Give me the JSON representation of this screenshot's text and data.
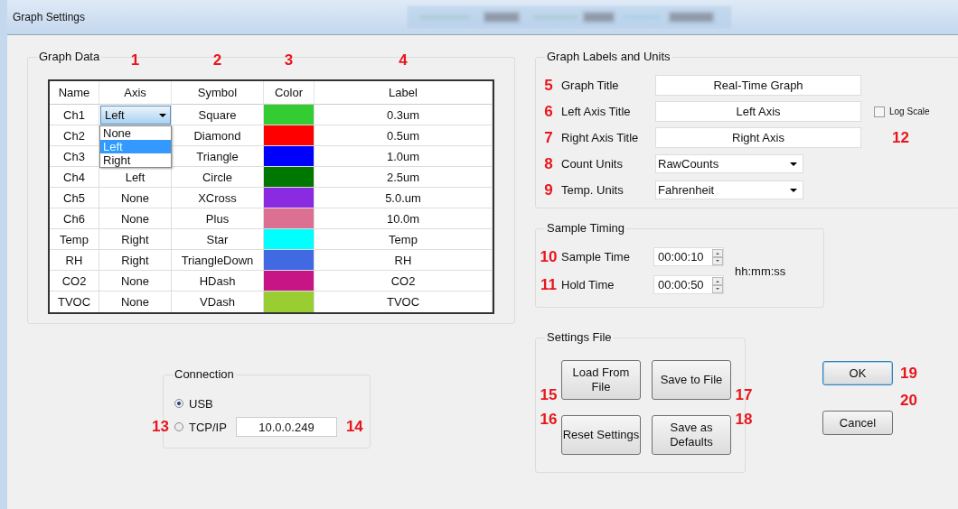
{
  "window": {
    "title": "Graph Settings"
  },
  "graph_data": {
    "title": "Graph Data",
    "columns": [
      {
        "label": "Name"
      },
      {
        "label": "Axis",
        "marker": "1"
      },
      {
        "label": "Symbol",
        "marker": "2"
      },
      {
        "label": "Color",
        "marker": "3"
      },
      {
        "label": "Label",
        "marker": "4"
      }
    ],
    "rows": [
      {
        "name": "Ch1",
        "axis": "Left",
        "symbol": "Square",
        "color": "#33cc33",
        "label": "0.3um",
        "editing": true
      },
      {
        "name": "Ch2",
        "symbol": "Diamond",
        "color": "#ff0000",
        "label": "0.5um",
        "editing": false
      },
      {
        "name": "Ch3",
        "symbol": "Triangle",
        "color": "#0000ff",
        "label": "1.0um",
        "editing": false
      },
      {
        "name": "Ch4",
        "axis": "Left",
        "symbol": "Circle",
        "color": "#007700",
        "label": "2.5um",
        "editing": false
      },
      {
        "name": "Ch5",
        "axis": "None",
        "symbol": "XCross",
        "color": "#8a2be2",
        "label": "5.0.um",
        "editing": false
      },
      {
        "name": "Ch6",
        "axis": "None",
        "symbol": "Plus",
        "color": "#db7093",
        "label": "10.0m",
        "editing": false
      },
      {
        "name": "Temp",
        "axis": "Right",
        "symbol": "Star",
        "color": "#00ffff",
        "label": "Temp",
        "editing": false
      },
      {
        "name": "RH",
        "axis": "Right",
        "symbol": "TriangleDown",
        "color": "#4169e1",
        "label": "RH",
        "editing": false
      },
      {
        "name": "CO2",
        "axis": "None",
        "symbol": "HDash",
        "color": "#c71585",
        "label": "CO2",
        "editing": false
      },
      {
        "name": "TVOC",
        "axis": "None",
        "symbol": "VDash",
        "color": "#9acd32",
        "label": "TVOC",
        "editing": false
      }
    ],
    "axis_options": [
      {
        "label": "None",
        "selected": false
      },
      {
        "label": "Left",
        "selected": true
      },
      {
        "label": "Right",
        "selected": false
      }
    ]
  },
  "connection": {
    "title": "Connection",
    "options": [
      {
        "label": "USB",
        "selected": true
      },
      {
        "label": "TCP/IP",
        "selected": false,
        "marker": "13"
      }
    ],
    "ip": {
      "value": "10.0.0.249",
      "marker": "14"
    }
  },
  "labels_units": {
    "title": "Graph Labels and Units",
    "fields": [
      {
        "kind": "text",
        "marker": "5",
        "label": "Graph Title",
        "value": "Real-Time Graph"
      },
      {
        "kind": "text",
        "marker": "6",
        "label": "Left Axis Title",
        "value": "Left Axis"
      },
      {
        "kind": "text",
        "marker": "7",
        "label": "Right Axis Title",
        "value": "Right Axis"
      },
      {
        "kind": "select",
        "marker": "8",
        "label": "Count Units",
        "value": "RawCounts"
      },
      {
        "kind": "select",
        "marker": "9",
        "label": "Temp. Units",
        "value": "Fahrenheit"
      }
    ],
    "log_scale": {
      "label": "Log Scale",
      "checked": false,
      "marker": "12"
    }
  },
  "sample_timing": {
    "title": "Sample Timing",
    "fields": [
      {
        "marker": "10",
        "label": "Sample Time",
        "value": "00:00:10"
      },
      {
        "marker": "11",
        "label": "Hold Time",
        "value": "00:00:50"
      }
    ],
    "unit": "hh:mm:ss"
  },
  "settings_file": {
    "title": "Settings File",
    "buttons": [
      {
        "label": "Load From File",
        "marker": "15"
      },
      {
        "label": "Save to File",
        "marker": "17"
      },
      {
        "label": "Reset Settings",
        "marker": "16"
      },
      {
        "label": "Save as Defaults",
        "marker": "18"
      }
    ]
  },
  "dialog_buttons": [
    {
      "label": "OK",
      "focused": true,
      "marker": "19"
    },
    {
      "label": "Cancel",
      "focused": false,
      "marker": "20"
    }
  ]
}
